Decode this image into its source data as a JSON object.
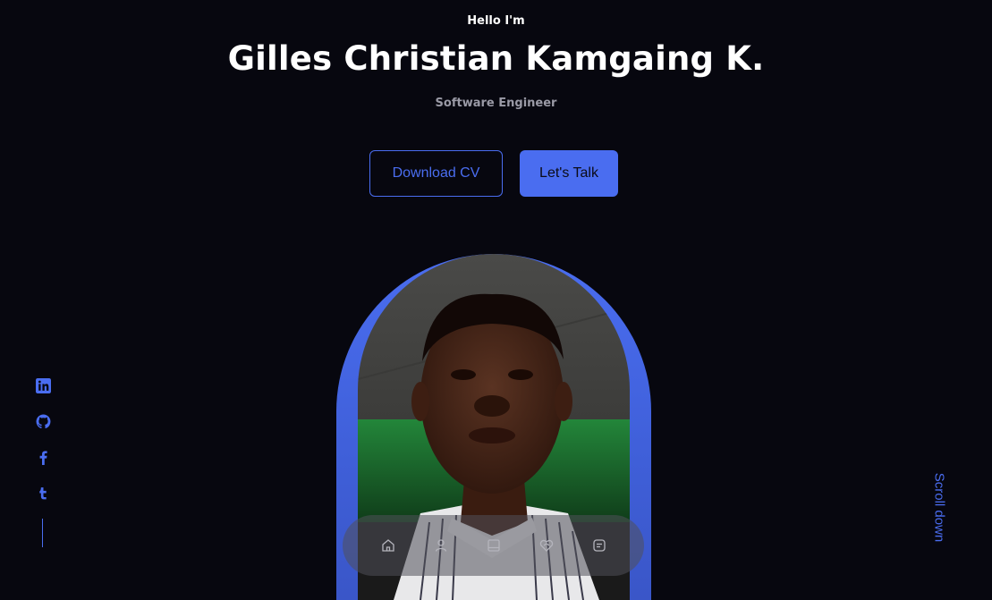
{
  "hero": {
    "greeting": "Hello I'm",
    "name": "Gilles Christian Kamgaing K.",
    "role": "Software Engineer"
  },
  "actions": {
    "download_label": "Download CV",
    "talk_label": "Let's Talk"
  },
  "scroll": {
    "label": "Scroll down"
  },
  "socials": [
    {
      "icon": "linkedin-icon"
    },
    {
      "icon": "github-icon"
    },
    {
      "icon": "facebook-icon"
    },
    {
      "icon": "tumblr-icon"
    }
  ],
  "nav": [
    {
      "icon": "home-icon"
    },
    {
      "icon": "user-icon"
    },
    {
      "icon": "book-icon"
    },
    {
      "icon": "services-icon"
    },
    {
      "icon": "message-icon"
    }
  ],
  "colors": {
    "background": "#07070f",
    "accent": "#4a6df0",
    "muted_text": "#9a9aa6"
  }
}
